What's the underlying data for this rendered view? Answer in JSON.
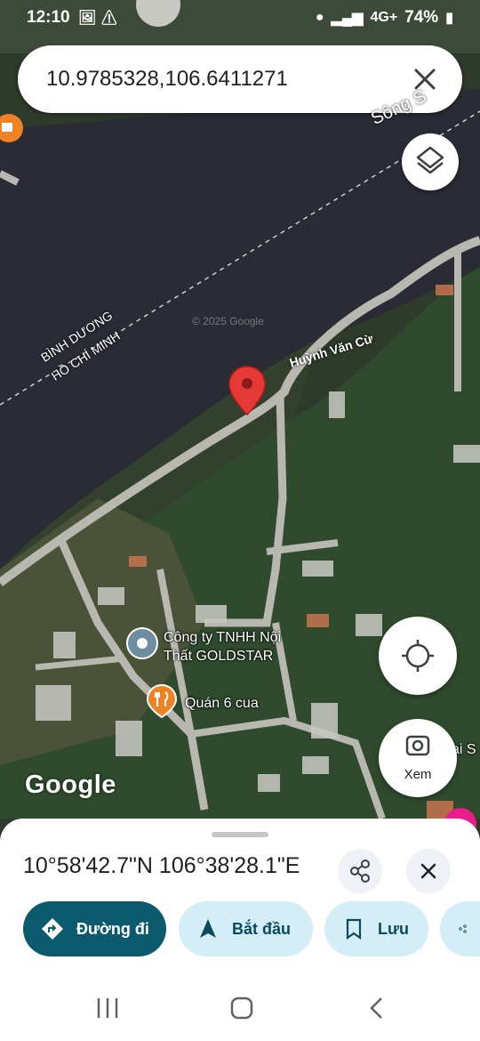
{
  "status_bar": {
    "time": "12:10",
    "network": "4G+",
    "battery": "74%"
  },
  "search": {
    "query": "10.9785328,106.6411271",
    "close_icon": "close-icon"
  },
  "map": {
    "watermark": "© 2025 Google",
    "road_label": "Huỳnh Văn Cừ",
    "river_label": "Sông S",
    "border_label_1": "BÌNH DƯƠNG",
    "border_label_2": "HỒ CHÍ MINH",
    "poi_1": {
      "name_line1": "Công ty TNHH Nội",
      "name_line2": "Thất GOLDSTAR",
      "icon": "pin-icon"
    },
    "poi_2": {
      "name": "Quán 6 cua",
      "icon": "restaurant-icon"
    },
    "partial_label": "ai S",
    "logo": "Google",
    "pin_color": "#e53935"
  },
  "fabs": {
    "layers_icon": "layers-icon",
    "locate_icon": "my-location-icon",
    "lens_label": "Xem"
  },
  "sheet": {
    "coords": "10°58'42.7\"N 106°38'28.1\"E",
    "buttons": {
      "directions": "Đường đi",
      "start": "Bắt đầu",
      "save": "Lưu"
    }
  },
  "colors": {
    "primary": "#0b5a6e",
    "secondary_bg": "#d4eef7"
  }
}
